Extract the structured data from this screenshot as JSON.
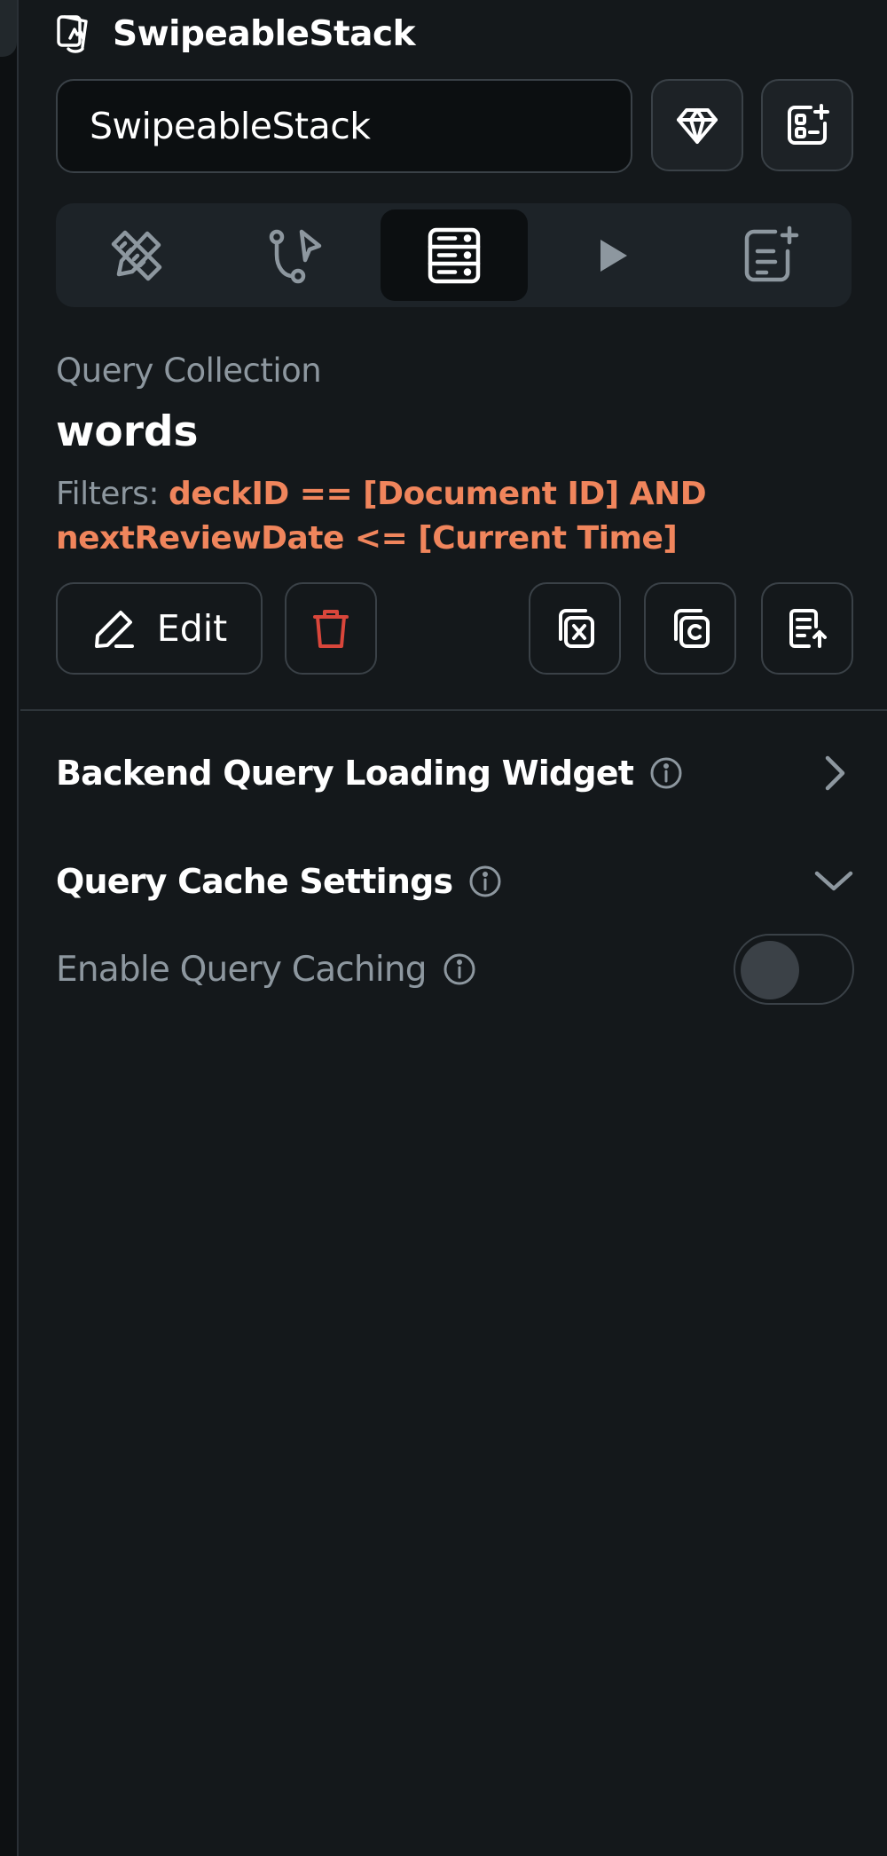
{
  "header": {
    "title": "SwipeableStack"
  },
  "widget_name_input": {
    "value": "SwipeableStack"
  },
  "tabs": [
    {
      "icon": "ruler-pencil-icon",
      "active": false
    },
    {
      "icon": "action-flow-icon",
      "active": false
    },
    {
      "icon": "database-icon",
      "active": true
    },
    {
      "icon": "play-icon",
      "active": false
    },
    {
      "icon": "add-note-icon",
      "active": false
    }
  ],
  "query": {
    "section_label": "Query Collection",
    "collection": "words",
    "filters_label": "Filters:",
    "filters_expression": "deckID == [Document ID] AND nextReviewDate <= [Current Time]"
  },
  "actions": {
    "edit_label": "Edit"
  },
  "sections": {
    "loading_widget": "Backend Query Loading Widget",
    "cache_settings": "Query Cache Settings",
    "enable_caching": "Enable Query Caching"
  },
  "toggle": {
    "enable_caching_on": false
  },
  "colors": {
    "background": "#14181b",
    "filter_expression": "#f0855c",
    "delete_icon": "#d9463b",
    "muted_text": "#8d979f"
  }
}
